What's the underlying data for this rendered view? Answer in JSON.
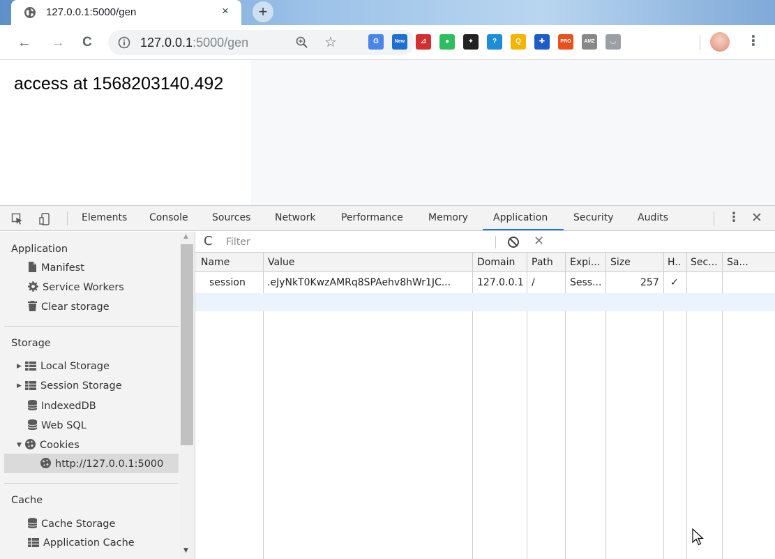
{
  "browser": {
    "tab_title": "127.0.0.1:5000/gen",
    "tab_close": "×",
    "new_tab": "+",
    "url_host": "127.0.0.1",
    "url_path": ":5000/gen",
    "back": "←",
    "forward": "→",
    "reload": "C",
    "star": "☆",
    "menu": "⋮",
    "extensions": [
      {
        "icon": "translate-icon",
        "label": "G",
        "color": "#4a86e8"
      },
      {
        "icon": "new-badge-icon",
        "label": "New",
        "color": "#1e6fd0"
      },
      {
        "icon": "pdf-icon",
        "label": "⊿",
        "color": "#d32f2f"
      },
      {
        "icon": "evernote-icon",
        "label": "●",
        "color": "#2dbe60"
      },
      {
        "icon": "ninja-icon",
        "label": "✦",
        "color": "#222222"
      },
      {
        "icon": "page-icon",
        "label": "?",
        "color": "#1a8fd8"
      },
      {
        "icon": "magnifier-icon",
        "label": "Q",
        "color": "#f4b400"
      },
      {
        "icon": "proxy-icon",
        "label": "✚",
        "color": "#1e5cc8"
      },
      {
        "icon": "pro-icon",
        "label": "PRO",
        "color": "#e8501e"
      },
      {
        "icon": "amz-icon",
        "label": "AMZ",
        "color": "#888888"
      },
      {
        "icon": "smile-icon",
        "label": "◡",
        "color": "#9aa0a6"
      }
    ]
  },
  "page": {
    "text": "access at 1568203140.492"
  },
  "devtools": {
    "tabs": [
      "Elements",
      "Console",
      "Sources",
      "Network",
      "Performance",
      "Memory",
      "Application",
      "Security",
      "Audits"
    ],
    "active_tab": "Application",
    "menu": "⋮",
    "close": "✕",
    "sidebar": {
      "application_header": "Application",
      "application_items": [
        "Manifest",
        "Service Workers",
        "Clear storage"
      ],
      "storage_header": "Storage",
      "storage_items": [
        "Local Storage",
        "Session Storage",
        "IndexedDB",
        "Web SQL",
        "Cookies"
      ],
      "cookie_origin": "http://127.0.0.1:5000",
      "cache_header": "Cache",
      "cache_items": [
        "Cache Storage",
        "Application Cache"
      ]
    },
    "filter": {
      "placeholder": "Filter",
      "refresh": "C",
      "clear": "✕"
    },
    "cookies_table": {
      "columns": [
        "Name",
        "Value",
        "Domain",
        "Path",
        "Expi...",
        "Size",
        "H..",
        "Sec...",
        "Sa..."
      ],
      "rows": [
        {
          "name": "session",
          "value": ".eJyNkT0KwzAMRq8SPAehv8hWr1JC...",
          "domain": "127.0.0.1",
          "path": "/",
          "expires": "Sess...",
          "size": "257",
          "http_only": "✓",
          "secure": "",
          "same_site": ""
        }
      ]
    }
  }
}
